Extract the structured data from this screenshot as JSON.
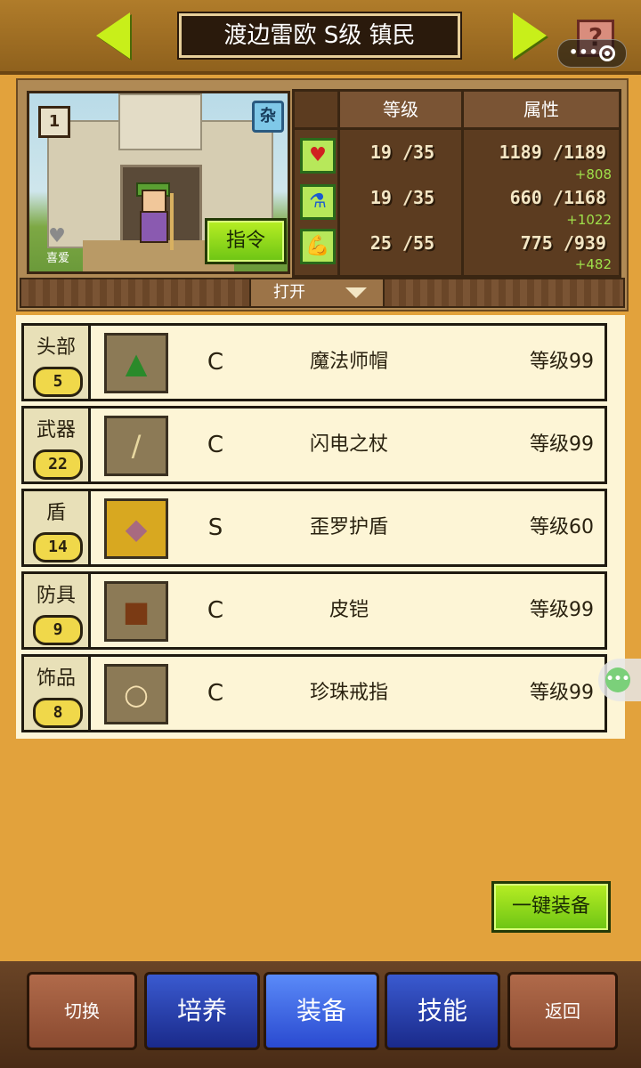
{
  "header": {
    "title": "渡边雷欧 S级 镇民",
    "prev_icon": "arrow-left",
    "next_icon": "arrow-right",
    "help_icon": "question-mark"
  },
  "character": {
    "rank_badge": "1",
    "type_badge": "杂",
    "favorite_label": "喜爱",
    "command_button": "指令"
  },
  "stats": {
    "header_level": "等级",
    "header_attribute": "属性",
    "rows": [
      {
        "icon": "heart-icon",
        "level": "19 /35",
        "value": "1189 /1189",
        "bonus": "+808"
      },
      {
        "icon": "potion-icon",
        "level": "19 /35",
        "value": "660 /1168",
        "bonus": "+1022"
      },
      {
        "icon": "arm-icon",
        "level": "25 /55",
        "value": "775 /939",
        "bonus": "+482"
      }
    ]
  },
  "open_label": "打开",
  "equipment": [
    {
      "slot": "头部",
      "count": "5",
      "icon": "hat-icon",
      "grade": "C",
      "name": "魔法师帽",
      "level": "等级99"
    },
    {
      "slot": "武器",
      "count": "22",
      "icon": "staff-icon",
      "grade": "C",
      "name": "闪电之杖",
      "level": "等级99"
    },
    {
      "slot": "盾",
      "count": "14",
      "icon": "shield-icon",
      "grade": "S",
      "name": "歪罗护盾",
      "level": "等级60"
    },
    {
      "slot": "防具",
      "count": "9",
      "icon": "armor-icon",
      "grade": "C",
      "name": "皮铠",
      "level": "等级99"
    },
    {
      "slot": "饰品",
      "count": "8",
      "icon": "ring-icon",
      "grade": "C",
      "name": "珍珠戒指",
      "level": "等级99"
    }
  ],
  "equip_all_button": "一键装备",
  "nav": {
    "switch": "切换",
    "train": "培养",
    "equip": "装备",
    "skills": "技能",
    "back": "返回"
  },
  "colors": {
    "background": "#e2a23c",
    "accent_green": "#8fdc1c",
    "nav_blue": "#2a4ad0",
    "bonus_green": "#9fe04a"
  }
}
